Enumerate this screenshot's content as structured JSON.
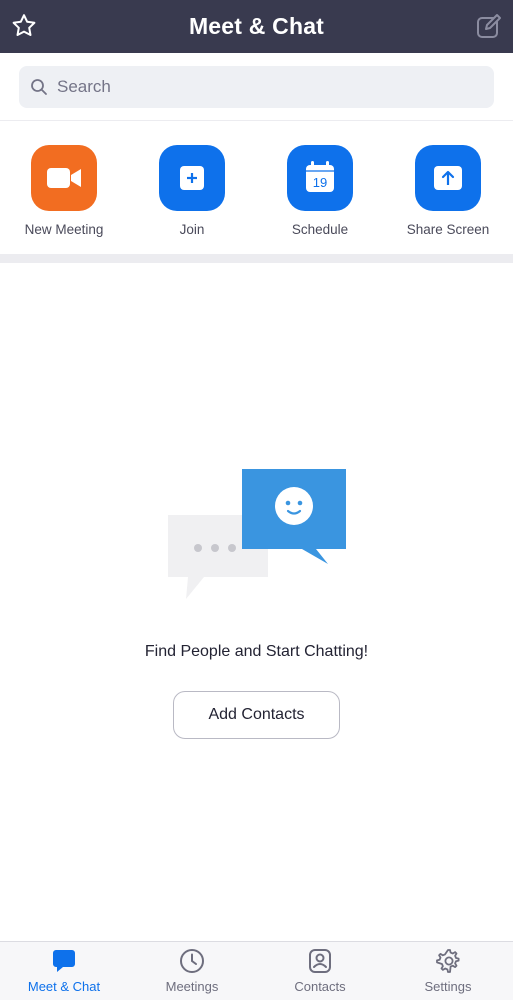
{
  "header": {
    "title": "Meet & Chat",
    "favorite_icon": "star-icon",
    "compose_icon": "edit-icon",
    "background": "#393a4f"
  },
  "search": {
    "placeholder": "Search",
    "value": "",
    "icon": "search-icon"
  },
  "actions": [
    {
      "label": "New Meeting",
      "icon": "video-camera-icon",
      "color": "#f26d21"
    },
    {
      "label": "Join",
      "icon": "plus-icon",
      "color": "#0e71eb"
    },
    {
      "label": "Schedule",
      "icon": "calendar-icon",
      "color": "#0e71eb",
      "calendar_day": "19"
    },
    {
      "label": "Share Screen",
      "icon": "share-screen-icon",
      "color": "#0e71eb"
    }
  ],
  "empty_state": {
    "illustration": "chat-bubbles-icon",
    "title": "Find People and Start Chatting!",
    "button_label": "Add Contacts"
  },
  "tabs": [
    {
      "label": "Meet & Chat",
      "icon": "chat-bubble-icon",
      "active": true
    },
    {
      "label": "Meetings",
      "icon": "clock-icon",
      "active": false
    },
    {
      "label": "Contacts",
      "icon": "contact-card-icon",
      "active": false
    },
    {
      "label": "Settings",
      "icon": "gear-icon",
      "active": false
    }
  ],
  "accent_color": "#0e71eb"
}
